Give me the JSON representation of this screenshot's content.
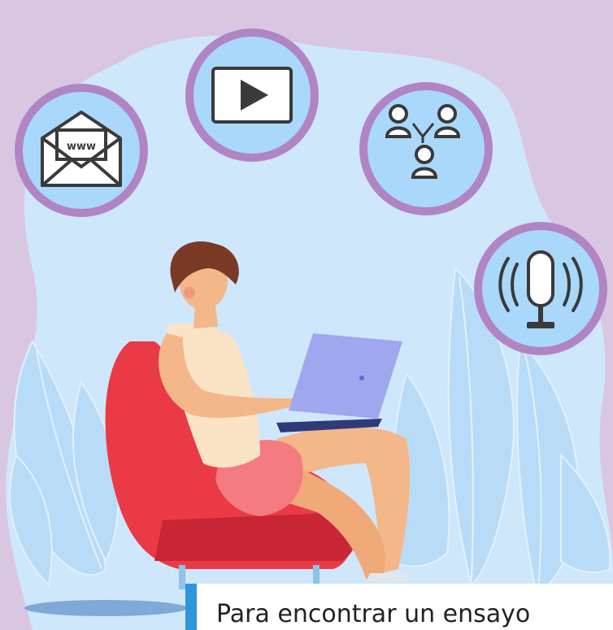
{
  "caption": {
    "text": "Para encontrar un ensayo"
  },
  "icons": [
    {
      "name": "envelope-www-icon",
      "label": "www"
    },
    {
      "name": "video-play-icon"
    },
    {
      "name": "people-network-icon"
    },
    {
      "name": "microphone-broadcast-icon"
    }
  ],
  "colors": {
    "background": "#d9c7e2",
    "blob": "#cfe7fb",
    "icon_fill": "#a9d8fb",
    "icon_ring": "#b184c4",
    "chair": "#e93a45",
    "laptop": "#9fa7ef",
    "shorts": "#f47b80",
    "hair": "#7a3a26",
    "caption_accent": "#2f95dc"
  }
}
